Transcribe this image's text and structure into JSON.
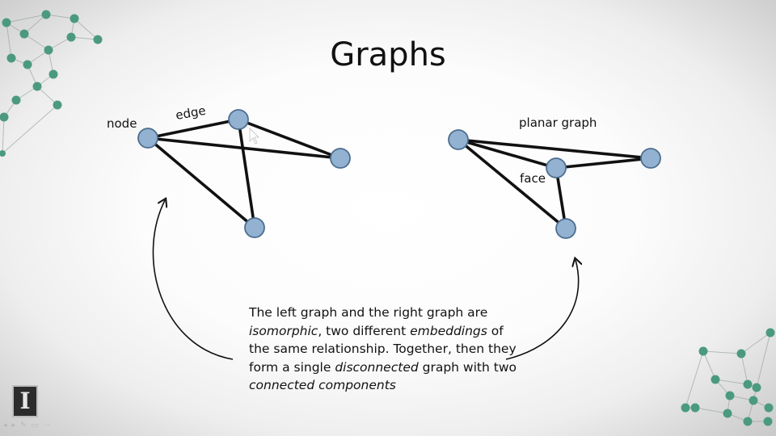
{
  "slide": {
    "title": "Graphs"
  },
  "labels": {
    "node": "node",
    "edge": "edge",
    "planar_graph": "planar graph",
    "face": "face"
  },
  "caption": {
    "segments": [
      {
        "text": "The left graph and the right graph are ",
        "italic": false
      },
      {
        "text": "isomorphic",
        "italic": true
      },
      {
        "text": ", two different ",
        "italic": false
      },
      {
        "text": "embeddings",
        "italic": true
      },
      {
        "text": " of the same relationship. Together, then they form a single ",
        "italic": false
      },
      {
        "text": "disconnected",
        "italic": true
      },
      {
        "text": " graph with two ",
        "italic": false
      },
      {
        "text": "connected components",
        "italic": true
      }
    ]
  },
  "logo": {
    "glyph": "I",
    "icon": "university-block-i-logo"
  },
  "controls": {
    "glyphs": [
      "◂",
      "▸",
      "✎",
      "▭",
      "⋯"
    ]
  },
  "colors": {
    "node_fill": "#93b1d0",
    "node_stroke": "#4d6e8f",
    "edge": "#111111",
    "decor_dot": "#4b9a7f",
    "decor_line": "#9aa7a3"
  },
  "graphs": {
    "left": {
      "nodes": [
        "A",
        "B",
        "C",
        "D"
      ],
      "edges": [
        [
          "A",
          "B"
        ],
        [
          "A",
          "C"
        ],
        [
          "A",
          "D"
        ],
        [
          "B",
          "C"
        ],
        [
          "B",
          "D"
        ]
      ]
    },
    "right": {
      "nodes": [
        "A",
        "B",
        "C",
        "D"
      ],
      "edges": [
        [
          "A",
          "B"
        ],
        [
          "A",
          "C"
        ],
        [
          "A",
          "D"
        ],
        [
          "B",
          "C"
        ],
        [
          "B",
          "D"
        ]
      ]
    }
  }
}
